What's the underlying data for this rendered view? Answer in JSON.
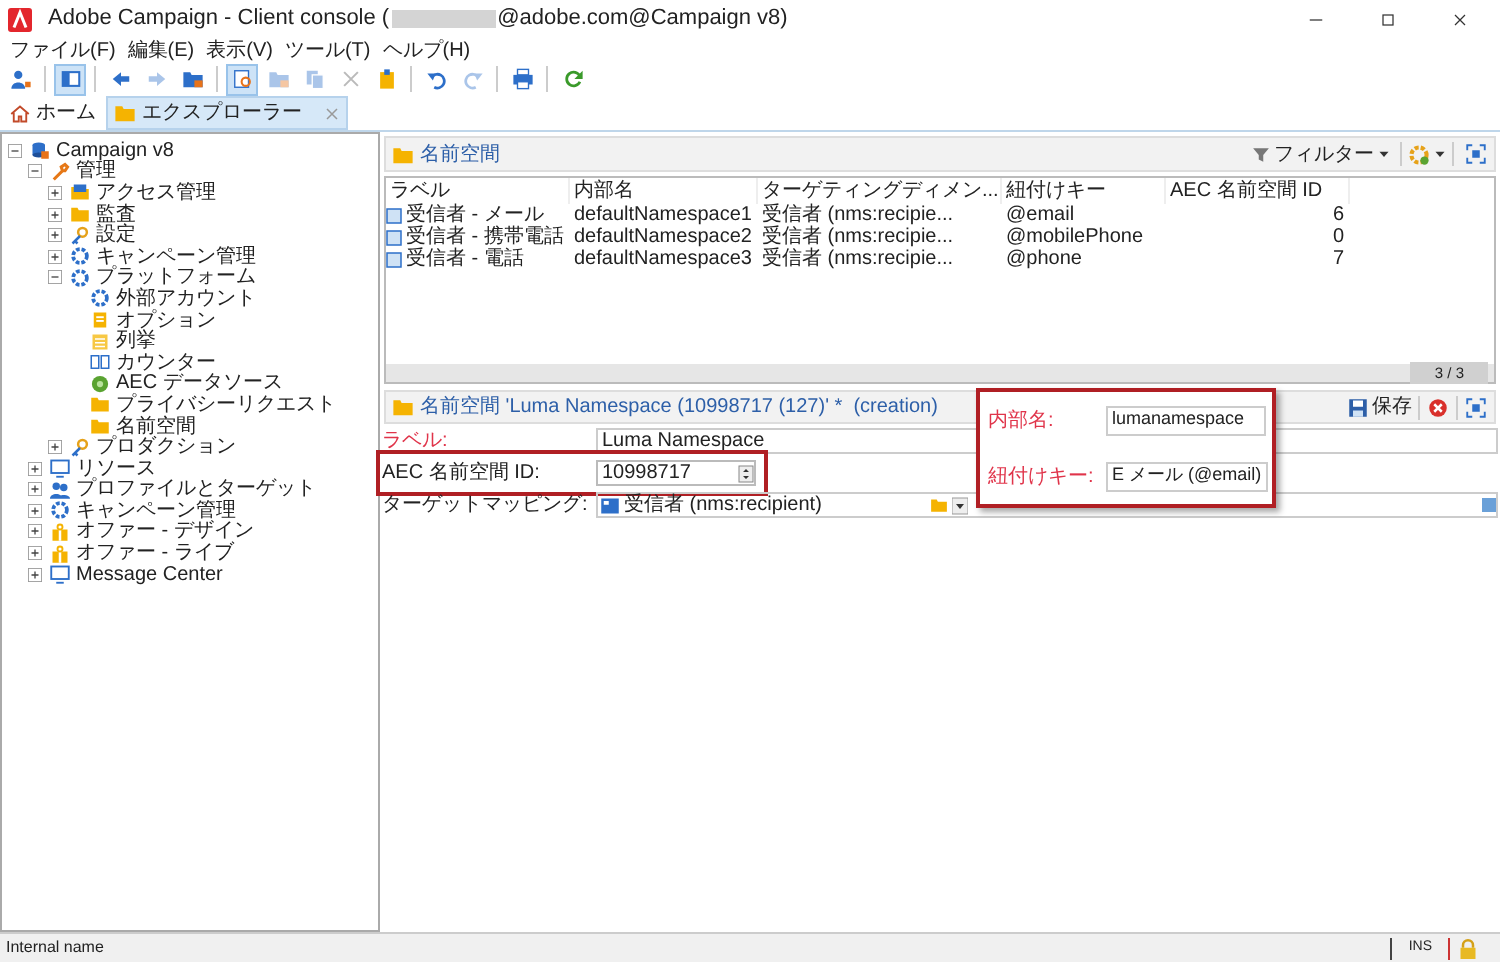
{
  "window": {
    "title_start": "Adobe Campaign - Client console (",
    "title_end": "@adobe.com@Campaign v8)"
  },
  "menu": [
    "ファイル(F)",
    "編集(E)",
    "表示(V)",
    "ツール(T)",
    "ヘルプ(H)"
  ],
  "toolbar": [
    {
      "kind": "user",
      "selected": false,
      "disabled": false
    },
    {
      "kind": "panel",
      "selected": true,
      "disabled": false
    },
    {
      "kind": "back",
      "selected": false,
      "disabled": false
    },
    {
      "kind": "forward",
      "selected": false,
      "disabled": true
    },
    {
      "kind": "folder",
      "selected": false,
      "disabled": false
    },
    {
      "kind": "find",
      "selected": true,
      "disabled": false
    },
    {
      "kind": "folder",
      "selected": false,
      "disabled": true
    },
    {
      "kind": "copy",
      "selected": false,
      "disabled": true
    },
    {
      "kind": "cut",
      "selected": false,
      "disabled": true
    },
    {
      "kind": "paste",
      "selected": false,
      "disabled": false
    },
    {
      "kind": "undo",
      "selected": false,
      "disabled": false
    },
    {
      "kind": "redo",
      "selected": false,
      "disabled": true
    },
    {
      "kind": "print",
      "selected": false,
      "disabled": false
    },
    {
      "kind": "refresh",
      "selected": false,
      "disabled": false
    }
  ],
  "tabs": [
    {
      "label": "ホーム",
      "kind": "home",
      "selected": false
    },
    {
      "label": "エクスプローラー",
      "kind": "folder",
      "selected": true
    }
  ],
  "tree": [
    {
      "label": "Campaign v8",
      "expanded": true,
      "children": [
        {
          "label": "管理",
          "expanded": true,
          "children": [
            {
              "label": "アクセス管理",
              "expanded": false
            },
            {
              "label": "監査",
              "expanded": false
            },
            {
              "label": "設定",
              "expanded": false
            },
            {
              "label": "キャンペーン管理",
              "expanded": false
            },
            {
              "label": "プラットフォーム",
              "expanded": true,
              "children": [
                {
                  "label": "外部アカウント"
                },
                {
                  "label": "オプション"
                },
                {
                  "label": "列挙"
                },
                {
                  "label": "カウンター"
                },
                {
                  "label": "AEC データソース"
                },
                {
                  "label": "プライバシーリクエスト"
                },
                {
                  "label": "名前空間"
                }
              ]
            },
            {
              "label": "プロダクション",
              "expanded": false
            }
          ]
        },
        {
          "label": "リソース",
          "expanded": false
        },
        {
          "label": "プロファイルとターゲット",
          "expanded": false
        },
        {
          "label": "キャンペーン管理",
          "expanded": false
        },
        {
          "label": "オファー - デザイン",
          "expanded": false
        },
        {
          "label": "オファー - ライブ",
          "expanded": false
        },
        {
          "label": "Message Center",
          "expanded": false
        }
      ]
    }
  ],
  "list": {
    "title": "名前空間",
    "filter": "フィルター",
    "columns": [
      "ラベル",
      "内部名",
      "ターゲティングディメン...",
      "紐付けキー",
      "AEC 名前空間 ID"
    ],
    "rows": [
      [
        "受信者 - メール",
        "defaultNamespace1",
        "受信者 (nms:recipie...",
        "@email",
        "6"
      ],
      [
        "受信者 - 携帯電話",
        "defaultNamespace2",
        "受信者 (nms:recipie...",
        "@mobilePhone",
        "0"
      ],
      [
        "受信者 - 電話",
        "defaultNamespace3",
        "受信者 (nms:recipie...",
        "@phone",
        "7"
      ]
    ],
    "count": "3 / 3"
  },
  "form": {
    "title": "名前空間 'Luma Namespace (10998717 (127)' *  (creation)",
    "save": "保存",
    "fields": [
      {
        "label": "ラベル:",
        "value": "Luma Namespace",
        "required": true,
        "kind": "text"
      },
      {
        "label": "AEC 名前空間 ID:",
        "value": "10998717",
        "required": false,
        "kind": "spin"
      },
      {
        "label": "ターゲットマッピング:",
        "value": "受信者 (nms:recipient)",
        "required": false,
        "kind": "link"
      }
    ],
    "callout_fields": [
      {
        "label": "内部名:",
        "value": "lumanamespace",
        "required": true
      },
      {
        "label": "紐付けキー:",
        "value": "E メール (@email)",
        "required": true
      }
    ]
  },
  "status_bar": {
    "text": "Internal name",
    "mode": "INS"
  }
}
